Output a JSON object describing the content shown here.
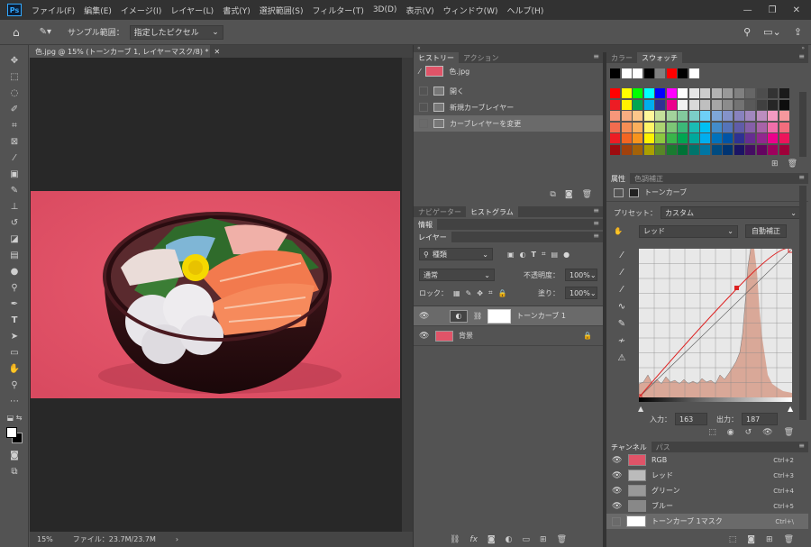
{
  "app": {
    "logo": "Ps"
  },
  "menubar": {
    "items": [
      "ファイル(F)",
      "編集(E)",
      "イメージ(I)",
      "レイヤー(L)",
      "書式(Y)",
      "選択範囲(S)",
      "フィルター(T)",
      "3D(D)",
      "表示(V)",
      "ウィンドウ(W)",
      "ヘルプ(H)"
    ],
    "controls": [
      "—",
      "❐",
      "✕"
    ]
  },
  "options_bar": {
    "sample_label": "サンプル範囲：",
    "sample_value": "指定したピクセル"
  },
  "document": {
    "tab_title": "色.jpg @ 15% (トーンカーブ 1, レイヤーマスク/8) *",
    "zoom": "15%",
    "file_info": "ファイル：23.7M/23.7M"
  },
  "history": {
    "tabs": [
      "ヒストリー",
      "アクション"
    ],
    "snapshot": "色.jpg",
    "items": [
      "開く",
      "新規カーブレイヤー",
      "カーブレイヤーを変更"
    ]
  },
  "navigator": {
    "tabs": [
      "ナビゲーター",
      "ヒストグラム"
    ]
  },
  "info": {
    "tab": "情報"
  },
  "layers": {
    "tab": "レイヤー",
    "filter": "種類",
    "blend_mode": "通常",
    "opacity_label": "不透明度：",
    "opacity_value": "100%",
    "lock_label": "ロック：",
    "fill_label": "塗り：",
    "fill_value": "100%",
    "items": [
      {
        "name": "トーンカーブ 1"
      },
      {
        "name": "背景"
      }
    ]
  },
  "swatches": {
    "tabs": [
      "カラー",
      "スウォッチ"
    ],
    "recent": [
      "#000000",
      "#ffffff",
      "#ffffff",
      "#000000",
      "#808080",
      "#ff0000",
      "#000000",
      "#ffffff"
    ],
    "rows": [
      [
        "#ff0000",
        "#ffff00",
        "#00ff00",
        "#00ffff",
        "#0000ff",
        "#ff00ff",
        "#ffffff",
        "#e6e6e6",
        "#cccccc",
        "#b3b3b3",
        "#999999",
        "#808080",
        "#666666",
        "#4d4d4d",
        "#333333",
        "#1a1a1a"
      ],
      [
        "#ed1c24",
        "#fff200",
        "#00a651",
        "#00aeef",
        "#2e3192",
        "#ec008c",
        "#f2f2f2",
        "#d9d9d9",
        "#bfbfbf",
        "#a6a6a6",
        "#8c8c8c",
        "#737373",
        "#595959",
        "#404040",
        "#262626",
        "#0d0d0d"
      ],
      [
        "#f7977a",
        "#f9ad81",
        "#fdc68a",
        "#fff79a",
        "#c4df9b",
        "#a3d39c",
        "#82ca9d",
        "#7bcdc8",
        "#6ecff6",
        "#7ea7d8",
        "#8493ca",
        "#8882be",
        "#a187be",
        "#bc8dbf",
        "#f49ac2",
        "#f6989d"
      ],
      [
        "#f26c4f",
        "#f68e55",
        "#fbaf5c",
        "#fff467",
        "#acd372",
        "#7cc576",
        "#3bb878",
        "#1abbb4",
        "#00bff3",
        "#438cca",
        "#5574b9",
        "#605ca8",
        "#855fa8",
        "#a763a8",
        "#f06ea9",
        "#f26d7d"
      ],
      [
        "#ed1c24",
        "#f26522",
        "#f7941d",
        "#fff200",
        "#8dc73f",
        "#39b54a",
        "#00a651",
        "#00a99d",
        "#00aeef",
        "#0072bc",
        "#0054a6",
        "#2e3192",
        "#662d91",
        "#92278f",
        "#ec008c",
        "#ed145b"
      ],
      [
        "#9e0b0f",
        "#a0410d",
        "#a36209",
        "#aba000",
        "#598527",
        "#1a7b30",
        "#007236",
        "#00746b",
        "#0076a3",
        "#004b80",
        "#003471",
        "#1b1464",
        "#440e62",
        "#630460",
        "#9e005d",
        "#9e0039"
      ]
    ]
  },
  "properties": {
    "tabs": [
      "属性",
      "色調補正"
    ],
    "title": "トーンカーブ",
    "preset_label": "プリセット：",
    "preset_value": "カスタム",
    "channel_value": "レッド",
    "auto_button": "自動補正",
    "input_label": "入力：",
    "input_value": "163",
    "output_label": "出力：",
    "output_value": "187"
  },
  "channels": {
    "tabs": [
      "チャンネル",
      "パス"
    ],
    "items": [
      {
        "name": "RGB",
        "shortcut": "Ctrl+2"
      },
      {
        "name": "レッド",
        "shortcut": "Ctrl+3"
      },
      {
        "name": "グリーン",
        "shortcut": "Ctrl+4"
      },
      {
        "name": "ブルー",
        "shortcut": "Ctrl+5"
      },
      {
        "name": "トーンカーブ 1マスク",
        "shortcut": "Ctrl+\\"
      }
    ]
  }
}
